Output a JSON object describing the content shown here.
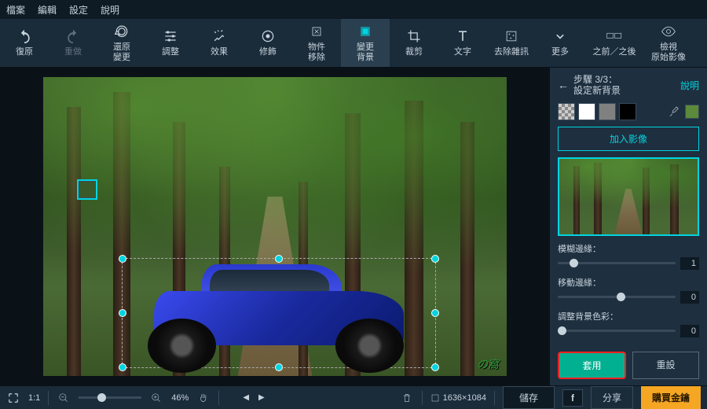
{
  "menu": {
    "file": "檔案",
    "edit": "編輯",
    "settings": "設定",
    "help": "說明"
  },
  "tools": {
    "undo": "復原",
    "redo": "重做",
    "revert": "還原\n變更",
    "adjust": "調整",
    "effects": "效果",
    "retouch": "修飾",
    "remove": "物件\n移除",
    "changebg": "變更\n背景",
    "crop": "裁剪",
    "text": "文字",
    "denoise": "去除雜訊",
    "more": "更多",
    "beforeafter": "之前／之後",
    "vieworiginal": "檢視\n原始影像"
  },
  "panel": {
    "step_label": "步驟 3/3：",
    "step_title": "設定新背景",
    "help": "說明",
    "add_image": "加入影像",
    "slider1": {
      "label": "模糊邊緣：",
      "value": "1",
      "pos": 10
    },
    "slider2": {
      "label": "移動邊緣：",
      "value": "0",
      "pos": 50
    },
    "slider3": {
      "label": "調整背景色彩：",
      "value": "0",
      "pos": 0
    },
    "apply": "套用",
    "reset": "重設",
    "swatches": [
      {
        "name": "transparent",
        "css": "trans"
      },
      {
        "name": "white",
        "bg": "#ffffff"
      },
      {
        "name": "gray",
        "bg": "#808080"
      },
      {
        "name": "black",
        "bg": "#000000"
      },
      {
        "name": "image",
        "bg": "#3a5a2a",
        "selected": true
      }
    ]
  },
  "status": {
    "fit": "1:1",
    "zoom": "46%",
    "dims": "1636×1084",
    "save": "儲存",
    "share": "分享",
    "buy": "購買金鑰"
  },
  "watermark": "の窩"
}
